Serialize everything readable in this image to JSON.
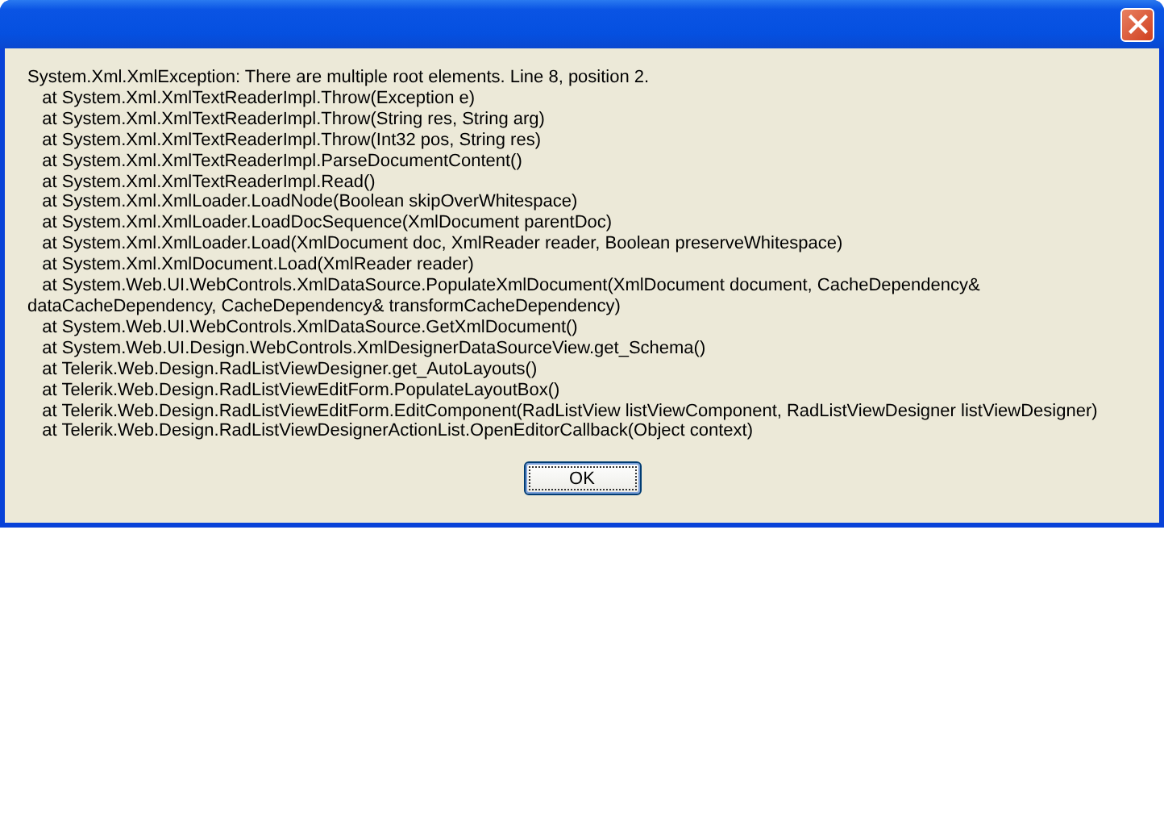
{
  "window": {
    "close_button": true
  },
  "message": [
    "System.Xml.XmlException: There are multiple root elements. Line 8, position 2.",
    "   at System.Xml.XmlTextReaderImpl.Throw(Exception e)",
    "   at System.Xml.XmlTextReaderImpl.Throw(String res, String arg)",
    "   at System.Xml.XmlTextReaderImpl.Throw(Int32 pos, String res)",
    "   at System.Xml.XmlTextReaderImpl.ParseDocumentContent()",
    "   at System.Xml.XmlTextReaderImpl.Read()",
    "   at System.Xml.XmlLoader.LoadNode(Boolean skipOverWhitespace)",
    "   at System.Xml.XmlLoader.LoadDocSequence(XmlDocument parentDoc)",
    "   at System.Xml.XmlLoader.Load(XmlDocument doc, XmlReader reader, Boolean preserveWhitespace)",
    "   at System.Xml.XmlDocument.Load(XmlReader reader)",
    "   at System.Web.UI.WebControls.XmlDataSource.PopulateXmlDocument(XmlDocument document, CacheDependency& dataCacheDependency, CacheDependency& transformCacheDependency)",
    "   at System.Web.UI.WebControls.XmlDataSource.GetXmlDocument()",
    "   at System.Web.UI.Design.WebControls.XmlDesignerDataSourceView.get_Schema()",
    "   at Telerik.Web.Design.RadListViewDesigner.get_AutoLayouts()",
    "   at Telerik.Web.Design.RadListViewEditForm.PopulateLayoutBox()",
    "   at Telerik.Web.Design.RadListViewEditForm.EditComponent(RadListView listViewComponent, RadListViewDesigner listViewDesigner)",
    "   at Telerik.Web.Design.RadListViewDesignerActionList.OpenEditorCallback(Object context)"
  ],
  "buttons": [
    {
      "label": "OK"
    }
  ]
}
